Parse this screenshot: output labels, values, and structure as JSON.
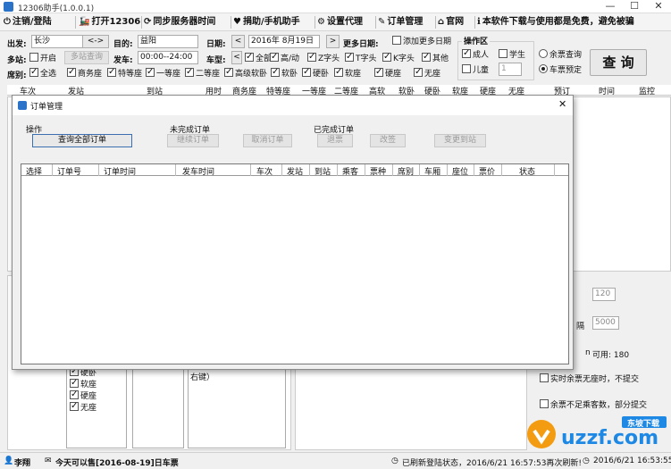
{
  "window": {
    "title": "12306助手(1.0.0.1)",
    "minimize": "—",
    "maximize": "☐",
    "close": "✕"
  },
  "toolbar": {
    "items": [
      {
        "icon": "⏻",
        "label": "注销/登陆"
      },
      {
        "icon": "🚂",
        "label": "打开12306"
      },
      {
        "icon": "⟳",
        "label": "同步服务器时间"
      },
      {
        "icon": "♥",
        "label": "捐助/手机助手"
      },
      {
        "icon": "⚙",
        "label": "设置代理"
      },
      {
        "icon": "✎",
        "label": "订单管理"
      },
      {
        "icon": "⌂",
        "label": "官网"
      },
      {
        "icon": "ℹ",
        "label": "本软件下载与使用都是免费，避免被骗"
      }
    ]
  },
  "search": {
    "from_label": "出发:",
    "from_value": "长沙",
    "swap_label": "<->",
    "to_label": "目的:",
    "to_value": "益阳",
    "date_label": "日期:",
    "date_prev": "<",
    "date_value": "2016年 8月19日",
    "date_next": ">",
    "more_date_label": "更多日期:",
    "add_more_date": "添加更多日期",
    "multi_station_label": "多站:",
    "multi_station_open": "开启",
    "multi_station_btn": "多站查询",
    "depart_label": "发车:",
    "depart_value": "00:00--24:00",
    "train_type_label": "车型:",
    "train_type_prev": "<",
    "train_types": [
      "全部",
      "高/动",
      "Z字头",
      "T字头",
      "K字头",
      "其他"
    ],
    "seat_label": "席别:",
    "seat_all": "全选",
    "seats": [
      "商务座",
      "特等座",
      "一等座",
      "二等座",
      "高级软卧",
      "软卧",
      "硬卧",
      "软座",
      "硬座",
      "无座"
    ]
  },
  "operation": {
    "title": "操作区",
    "adult": "成人",
    "student": "学生",
    "child": "儿童",
    "child_count": "1",
    "remain_query": "余票查询",
    "book": "车票预定",
    "query_btn": "查 询"
  },
  "result_header": [
    "车次",
    "发站",
    "到站",
    "用时",
    "商务座",
    "特等座",
    "一等座",
    "二等座",
    "高软",
    "软卧",
    "硬卧",
    "软座",
    "硬座",
    "无座",
    "预订",
    "时间",
    "监控"
  ],
  "modal": {
    "title": "订单管理",
    "close": "✕",
    "group_ops": "操作",
    "query_all": "查询全部订单",
    "group_unfinished": "未完成订单",
    "continue_pay": "继续订单",
    "cancel_order": "取消订单",
    "group_finished": "已完成订单",
    "refund": "退票",
    "change": "改签",
    "change_station": "变更到站",
    "columns": [
      "选择",
      "订单号",
      "订单时间",
      "发车时间",
      "车次",
      "发站",
      "到站",
      "乘客",
      "票种",
      "席别",
      "车厢",
      "座位",
      "票价",
      "状态"
    ]
  },
  "lower_left": {
    "seats": [
      "硬卧",
      "软座",
      "硬座",
      "无座"
    ],
    "extra": "右键）"
  },
  "right_panel": {
    "val1": "120",
    "gap_label": "隔",
    "val2": "5000",
    "n_label": "n",
    "available": "可用: 180",
    "no_commit_realtime": "实时余票无座时，不提交",
    "partial_commit": "余票不足乘客数，部分提交"
  },
  "status": {
    "user": "李翔",
    "sale_info": "今天可以售[2016-08-19]日车票",
    "refresh": "已刷新登陆状态，2016/6/21  16:57:53再次刷新!",
    "time": "2016/6/21  16:53:55"
  },
  "watermark": {
    "brand": "uzzf.com",
    "sub": "东坡下载"
  },
  "colors": {
    "accent": "#2a73c8",
    "logo_orange": "#f39c12",
    "logo_blue": "#1e88e5"
  }
}
